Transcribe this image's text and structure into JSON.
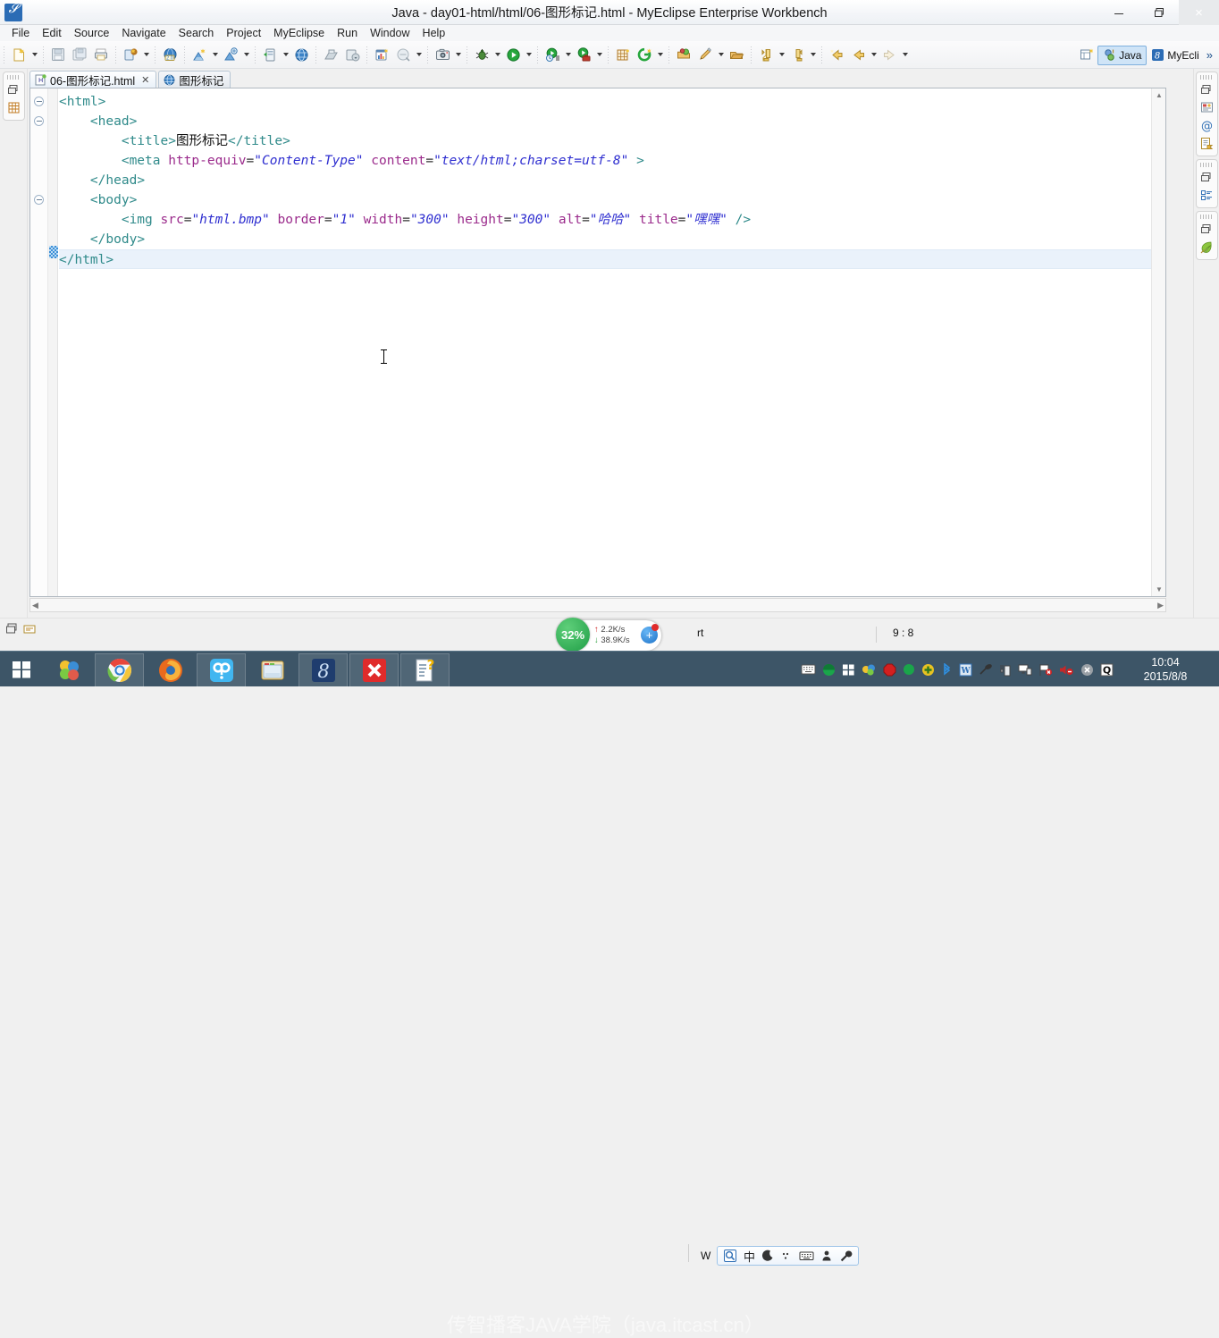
{
  "window": {
    "title": "Java - day01-html/html/06-图形标记.html - MyEclipse Enterprise Workbench",
    "app_icon": "myeclipse-icon",
    "minimize_label": "–",
    "maximize_label": "❐",
    "close_label": "×"
  },
  "menu": {
    "items": [
      {
        "label": "File"
      },
      {
        "label": "Edit"
      },
      {
        "label": "Source"
      },
      {
        "label": "Navigate"
      },
      {
        "label": "Search"
      },
      {
        "label": "Project"
      },
      {
        "label": "MyEclipse"
      },
      {
        "label": "Run"
      },
      {
        "label": "Window"
      },
      {
        "label": "Help"
      }
    ]
  },
  "toolbar": {
    "groups": [
      {
        "icons": [
          "new-file-icon"
        ],
        "arrow_after": true
      },
      {
        "icons": [
          "save-icon",
          "save-all-icon",
          "print-icon"
        ],
        "arrow_after": false
      },
      {
        "icons": [
          "myeclipse-deploy-icon"
        ],
        "arrow_after": true
      },
      {
        "icons": [
          "web20-icon"
        ],
        "arrow_after": false
      },
      {
        "icons": [
          "database-explorer-icon"
        ],
        "arrow_after": true
      },
      {
        "icons": [
          "database-icon"
        ],
        "arrow_after": true
      },
      {
        "icons": [
          "server-config-icon"
        ],
        "arrow_after": false
      },
      {
        "icons": [
          "server-run-icon"
        ],
        "arrow_after": true
      },
      {
        "icons": [
          "web-browser-icon"
        ],
        "arrow_after": false
      },
      {
        "icons": [
          "export-icon",
          "import-icon"
        ],
        "arrow_after": false
      },
      {
        "icons": [
          "report-icon",
          "no-search-icon"
        ],
        "arrow_after": true
      },
      {
        "icons": [
          "snapshot-icon"
        ],
        "arrow_after": true
      },
      {
        "icons": [
          "debug-bug-icon"
        ],
        "arrow_after": true
      },
      {
        "icons": [
          "run-play-icon"
        ],
        "arrow_after": true
      },
      {
        "icons": [
          "run-history-icon"
        ],
        "arrow_after": true
      },
      {
        "icons": [
          "run-toolbox-icon"
        ],
        "arrow_after": true
      },
      {
        "icons": [
          "new-table-icon",
          "new-wizard-icon"
        ],
        "arrow_after": true
      },
      {
        "icons": [
          "open-type-icon",
          "open-task-icon"
        ],
        "arrow_after": true
      },
      {
        "icons": [
          "open-resource-icon"
        ],
        "arrow_after": false
      },
      {
        "icons": [
          "next-annotation-icon"
        ],
        "arrow_after": true
      },
      {
        "icons": [
          "previous-annotation-icon"
        ],
        "arrow_after": true
      },
      {
        "icons": [
          "back-history-icon"
        ],
        "arrow_after": false
      },
      {
        "icons": [
          "back-arrow-icon"
        ],
        "arrow_after": true
      },
      {
        "icons": [
          "forward-arrow-icon"
        ],
        "arrow_after": true
      }
    ],
    "perspective": {
      "open_perspective_icon": "open-perspective-icon",
      "items": [
        {
          "icon": "java-perspective-icon",
          "label": "Java",
          "active": true
        },
        {
          "icon": "myeclipse-perspective-icon",
          "label": "MyEcli",
          "active": false
        }
      ],
      "chevron": "»"
    }
  },
  "left_rail": {
    "boxes": [
      {
        "icons": [
          "restore-view-icon",
          "package-explorer-icon"
        ]
      }
    ]
  },
  "right_rail": {
    "boxes": [
      {
        "icons": [
          "restore-view-icon",
          "snippets-icon",
          "at-outline-icon",
          "properties-icon"
        ]
      },
      {
        "icons": [
          "restore-view-icon",
          "outline-view-icon"
        ]
      },
      {
        "icons": [
          "restore-view-icon",
          "leaf-icon"
        ]
      }
    ]
  },
  "editor": {
    "tabs": [
      {
        "icon": "html-file-icon",
        "label": "06-图形标记.html",
        "close": "✕",
        "active": true
      },
      {
        "icon": "browser-globe-icon",
        "label": "图形标记",
        "close": "",
        "active": false
      }
    ],
    "code_lines": [
      {
        "fold": true,
        "indent": 0,
        "tokens": [
          {
            "t": "tagp",
            "s": "<"
          },
          {
            "t": "tag",
            "s": "html"
          },
          {
            "t": "tagp",
            "s": ">"
          }
        ]
      },
      {
        "fold": true,
        "indent": 1,
        "tokens": [
          {
            "t": "tagp",
            "s": "<"
          },
          {
            "t": "tag",
            "s": "head"
          },
          {
            "t": "tagp",
            "s": ">"
          }
        ]
      },
      {
        "fold": false,
        "indent": 2,
        "tokens": [
          {
            "t": "tagp",
            "s": "<"
          },
          {
            "t": "tag",
            "s": "title"
          },
          {
            "t": "tagp",
            "s": ">"
          },
          {
            "t": "txt",
            "s": "图形标记"
          },
          {
            "t": "tagp",
            "s": "</"
          },
          {
            "t": "tag",
            "s": "title"
          },
          {
            "t": "tagp",
            "s": ">"
          }
        ]
      },
      {
        "fold": false,
        "indent": 2,
        "tokens": [
          {
            "t": "tagp",
            "s": "<"
          },
          {
            "t": "tag",
            "s": "meta"
          },
          {
            "t": "eq",
            "s": " "
          },
          {
            "t": "attr",
            "s": "http-equiv"
          },
          {
            "t": "eq",
            "s": "="
          },
          {
            "t": "val",
            "s": "\"Content-Type\""
          },
          {
            "t": "eq",
            "s": " "
          },
          {
            "t": "attr",
            "s": "content"
          },
          {
            "t": "eq",
            "s": "="
          },
          {
            "t": "val",
            "s": "\"text/html;charset=utf-8\""
          },
          {
            "t": "eq",
            "s": " "
          },
          {
            "t": "tagp",
            "s": ">"
          }
        ]
      },
      {
        "fold": false,
        "indent": 1,
        "tokens": [
          {
            "t": "tagp",
            "s": "</"
          },
          {
            "t": "tag",
            "s": "head"
          },
          {
            "t": "tagp",
            "s": ">"
          }
        ]
      },
      {
        "fold": true,
        "indent": 1,
        "tokens": [
          {
            "t": "tagp",
            "s": "<"
          },
          {
            "t": "tag",
            "s": "body"
          },
          {
            "t": "tagp",
            "s": ">"
          }
        ]
      },
      {
        "fold": false,
        "indent": 2,
        "tokens": [
          {
            "t": "tagp",
            "s": "<"
          },
          {
            "t": "tag",
            "s": "img"
          },
          {
            "t": "eq",
            "s": " "
          },
          {
            "t": "attr",
            "s": "src"
          },
          {
            "t": "eq",
            "s": "="
          },
          {
            "t": "val",
            "s": "\"html.bmp\""
          },
          {
            "t": "eq",
            "s": " "
          },
          {
            "t": "attr",
            "s": "border"
          },
          {
            "t": "eq",
            "s": "="
          },
          {
            "t": "val",
            "s": "\"1\""
          },
          {
            "t": "eq",
            "s": " "
          },
          {
            "t": "attr",
            "s": "width"
          },
          {
            "t": "eq",
            "s": "="
          },
          {
            "t": "val",
            "s": "\"300\""
          },
          {
            "t": "eq",
            "s": " "
          },
          {
            "t": "attr",
            "s": "height"
          },
          {
            "t": "eq",
            "s": "="
          },
          {
            "t": "val",
            "s": "\"300\""
          },
          {
            "t": "eq",
            "s": " "
          },
          {
            "t": "attr",
            "s": "alt"
          },
          {
            "t": "eq",
            "s": "="
          },
          {
            "t": "val",
            "s": "\"哈哈\""
          },
          {
            "t": "eq",
            "s": " "
          },
          {
            "t": "attr",
            "s": "title"
          },
          {
            "t": "eq",
            "s": "="
          },
          {
            "t": "val",
            "s": "\"嘿嘿\""
          },
          {
            "t": "eq",
            "s": " "
          },
          {
            "t": "tagp",
            "s": "/>"
          }
        ]
      },
      {
        "fold": false,
        "indent": 1,
        "tokens": [
          {
            "t": "tagp",
            "s": "</"
          },
          {
            "t": "tag",
            "s": "body"
          },
          {
            "t": "tagp",
            "s": ">"
          }
        ]
      },
      {
        "fold": false,
        "indent": 0,
        "current": true,
        "tokens": [
          {
            "t": "tagp",
            "s": "</"
          },
          {
            "t": "tag",
            "s": "html"
          },
          {
            "t": "tagp",
            "s": ">"
          }
        ]
      }
    ],
    "scroll_up": "▲",
    "scroll_down": "▼",
    "scroll_left": "◀",
    "scroll_right": "▶"
  },
  "status": {
    "writable_text": "W",
    "insert_text": "rt",
    "cursor_position": "9 : 8"
  },
  "net_widget": {
    "percent": "32%",
    "upload": "2.2K/s",
    "download": "38.9K/s",
    "upload_arrow": "↑",
    "download_arrow": "↓",
    "plus_label": "+"
  },
  "ime": {
    "logo_icon": "sogou-ime-icon",
    "mode": "中",
    "moon_icon": "moon-icon",
    "punct_icon": "punctuation-icon",
    "keyboard_icon": "soft-keyboard-icon",
    "user_icon": "user-icon",
    "tools_icon": "wrench-icon"
  },
  "taskbar": {
    "start_icon": "windows-start-icon",
    "items": [
      {
        "icon": "mypc-icon",
        "pinned": false
      },
      {
        "icon": "chrome-icon",
        "pinned": true
      },
      {
        "icon": "firefox-icon",
        "pinned": false
      },
      {
        "icon": "app-blue-icon",
        "pinned": true
      },
      {
        "icon": "file-explorer-icon",
        "pinned": false
      },
      {
        "icon": "myeclipse-icon",
        "pinned": true
      },
      {
        "icon": "close-x-red-icon",
        "pinned": true
      },
      {
        "icon": "notepad-help-icon",
        "pinned": true
      }
    ],
    "watermark": "传智播客JAVA学院（java.itcast.cn）",
    "tray_icons": [
      "keyboard-icon",
      "green-circle-icon",
      "windows-tray-icon",
      "cloud-icon",
      "stop-red-icon",
      "green-dot-icon",
      "yellow-plus-icon",
      "bluetooth-icon",
      "word-icon",
      "antenna-icon",
      "usb-device-icon",
      "network-monitor-icon",
      "flag-error-icon",
      "volume-mute-icon",
      "close-gray-icon",
      "q-icon"
    ],
    "clock_time": "10:04",
    "clock_date": "2015/8/8"
  }
}
